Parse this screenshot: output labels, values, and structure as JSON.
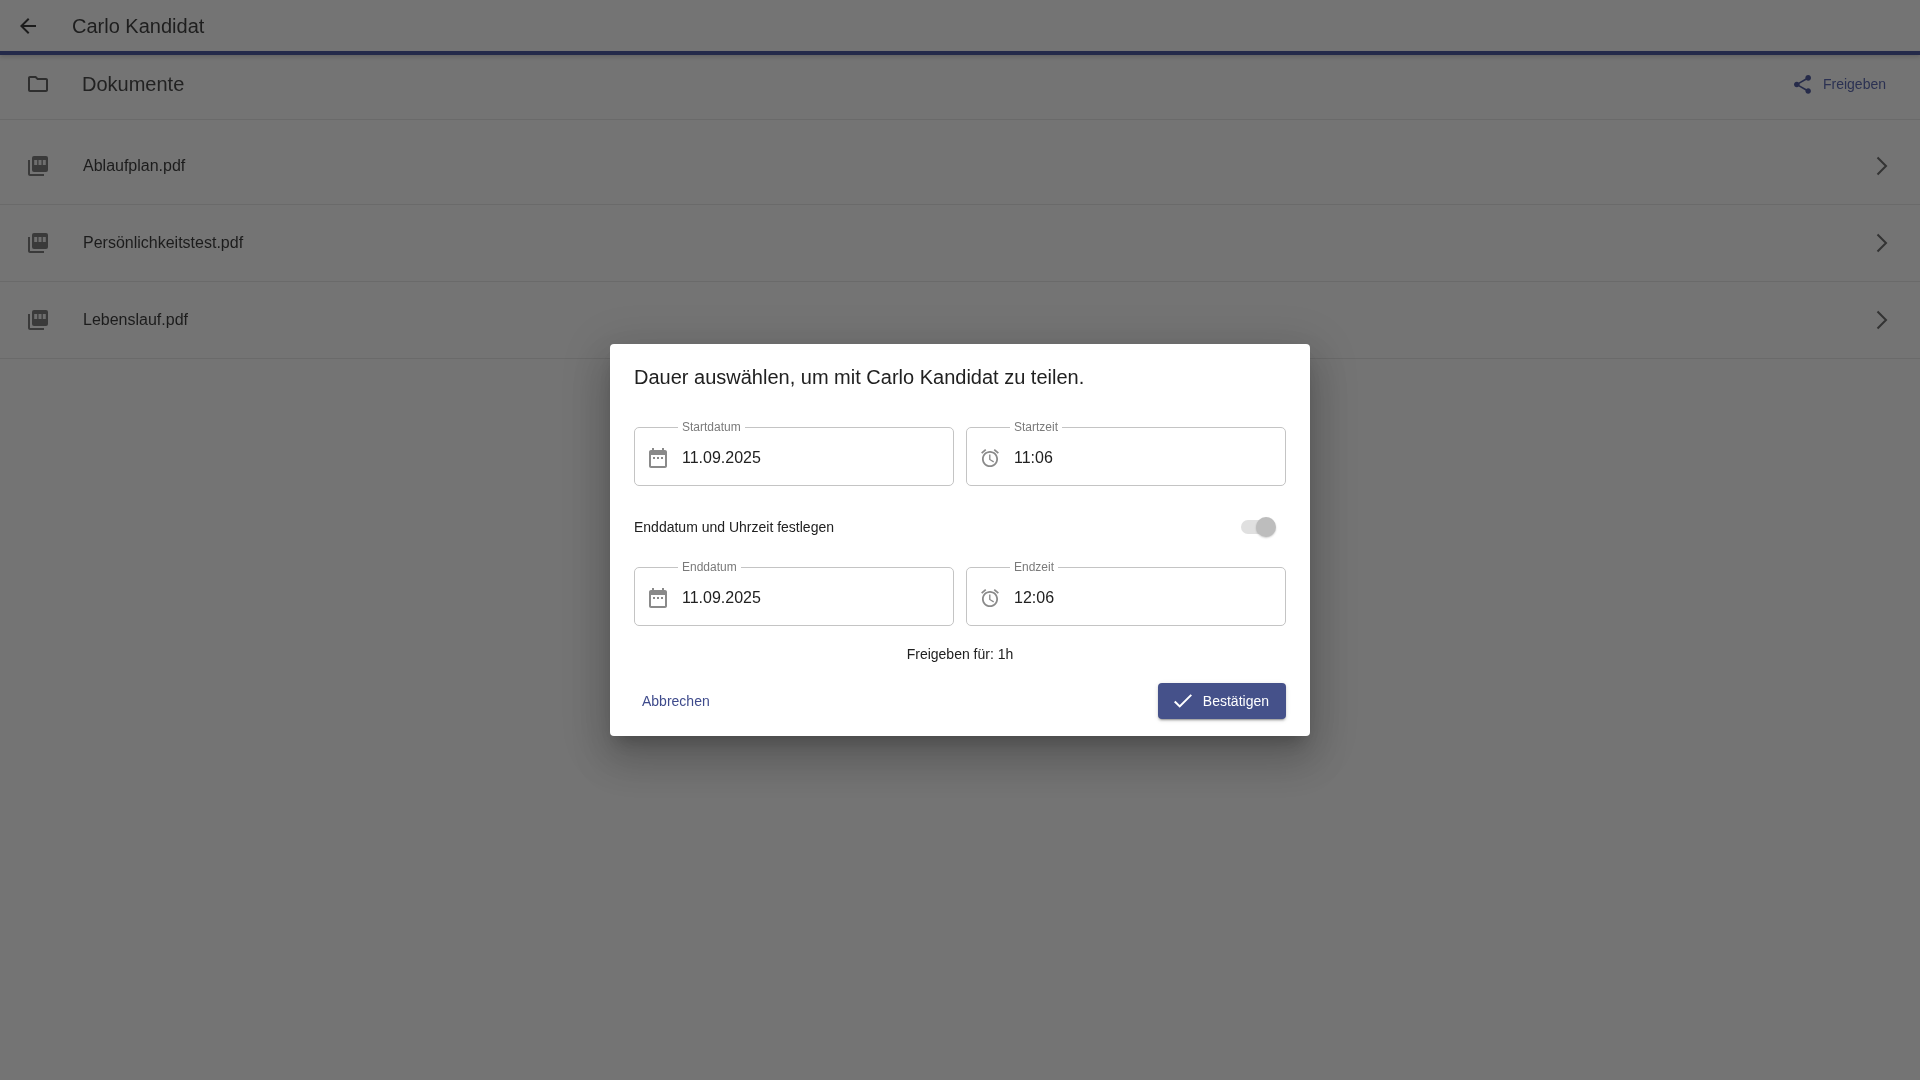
{
  "app_bar": {
    "title": "Carlo Kandidat"
  },
  "folder": {
    "title": "Dokumente",
    "share_button": "Freigeben"
  },
  "files": [
    {
      "name": "Ablaufplan.pdf"
    },
    {
      "name": "Persönlichkeitstest.pdf"
    },
    {
      "name": "Lebenslauf.pdf"
    }
  ],
  "dialog": {
    "title": "Dauer auswählen, um mit Carlo Kandidat zu teilen.",
    "start_fields": [
      {
        "kind": "date",
        "label": "Startdatum",
        "value": "11.09.2025"
      },
      {
        "kind": "time",
        "label": "Startzeit",
        "value": "11:06"
      }
    ],
    "end_toggle": {
      "label": "Enddatum und Uhrzeit festlegen",
      "on": true,
      "disabled": true
    },
    "end_fields": [
      {
        "kind": "date",
        "label": "Enddatum",
        "value": "11.09.2025"
      },
      {
        "kind": "time",
        "label": "Endzeit",
        "value": "12:06"
      }
    ],
    "summary": "Freigeben für: 1h",
    "cancel_button": "Abbrechen",
    "confirm_button": "Bestätigen"
  }
}
